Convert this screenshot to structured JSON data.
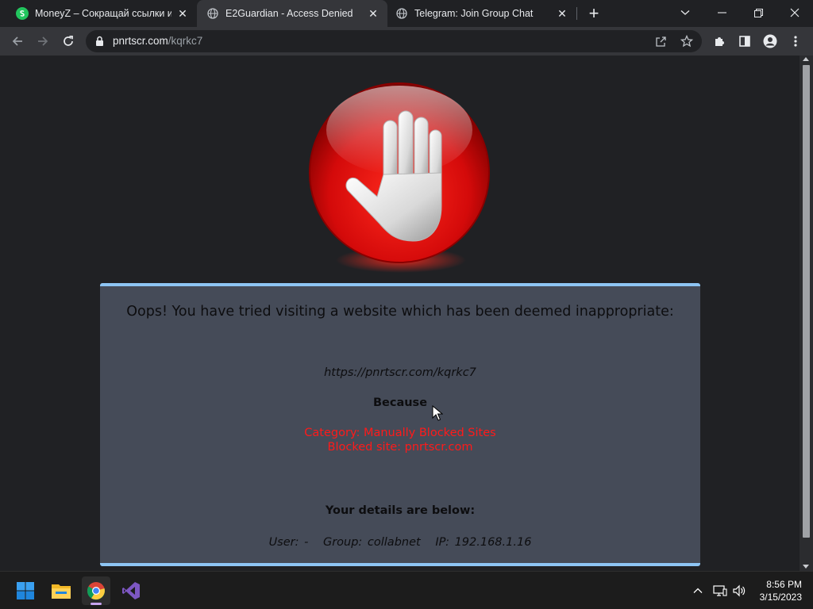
{
  "browser": {
    "tabs": [
      {
        "title": "MoneyZ – Сокращай ссылки и з",
        "favicon": "moneyz-icon",
        "active": false
      },
      {
        "title": "E2Guardian - Access Denied",
        "favicon": "globe-icon",
        "active": true
      },
      {
        "title": "Telegram: Join Group Chat",
        "favicon": "globe-icon",
        "active": false
      }
    ],
    "address": {
      "host": "pnrtscr.com",
      "path": "/kqrkc7"
    }
  },
  "page": {
    "heading": "Oops! You have tried visiting a website which has been deemed inappropriate:",
    "blocked_url": "https://pnrtscr.com/kqrkc7",
    "because_label": "Because",
    "reason_lines": [
      "Category: Manually Blocked Sites",
      "Blocked site: pnrtscr.com"
    ],
    "details_title": "Your details are below:",
    "details": {
      "user": "User: -",
      "group": "Group: collabnet",
      "ip": "IP: 192.168.1.16"
    },
    "colors": {
      "panel_bg": "#454b58",
      "panel_border": "#8ec5f4",
      "reason_text": "#ff1a1a",
      "page_bg": "#202124"
    }
  },
  "taskbar": {
    "apps": [
      "windows-start-icon",
      "file-explorer-icon",
      "chrome-icon",
      "visual-studio-icon"
    ],
    "clock": {
      "time": "8:56 PM",
      "date": "3/15/2023"
    }
  }
}
